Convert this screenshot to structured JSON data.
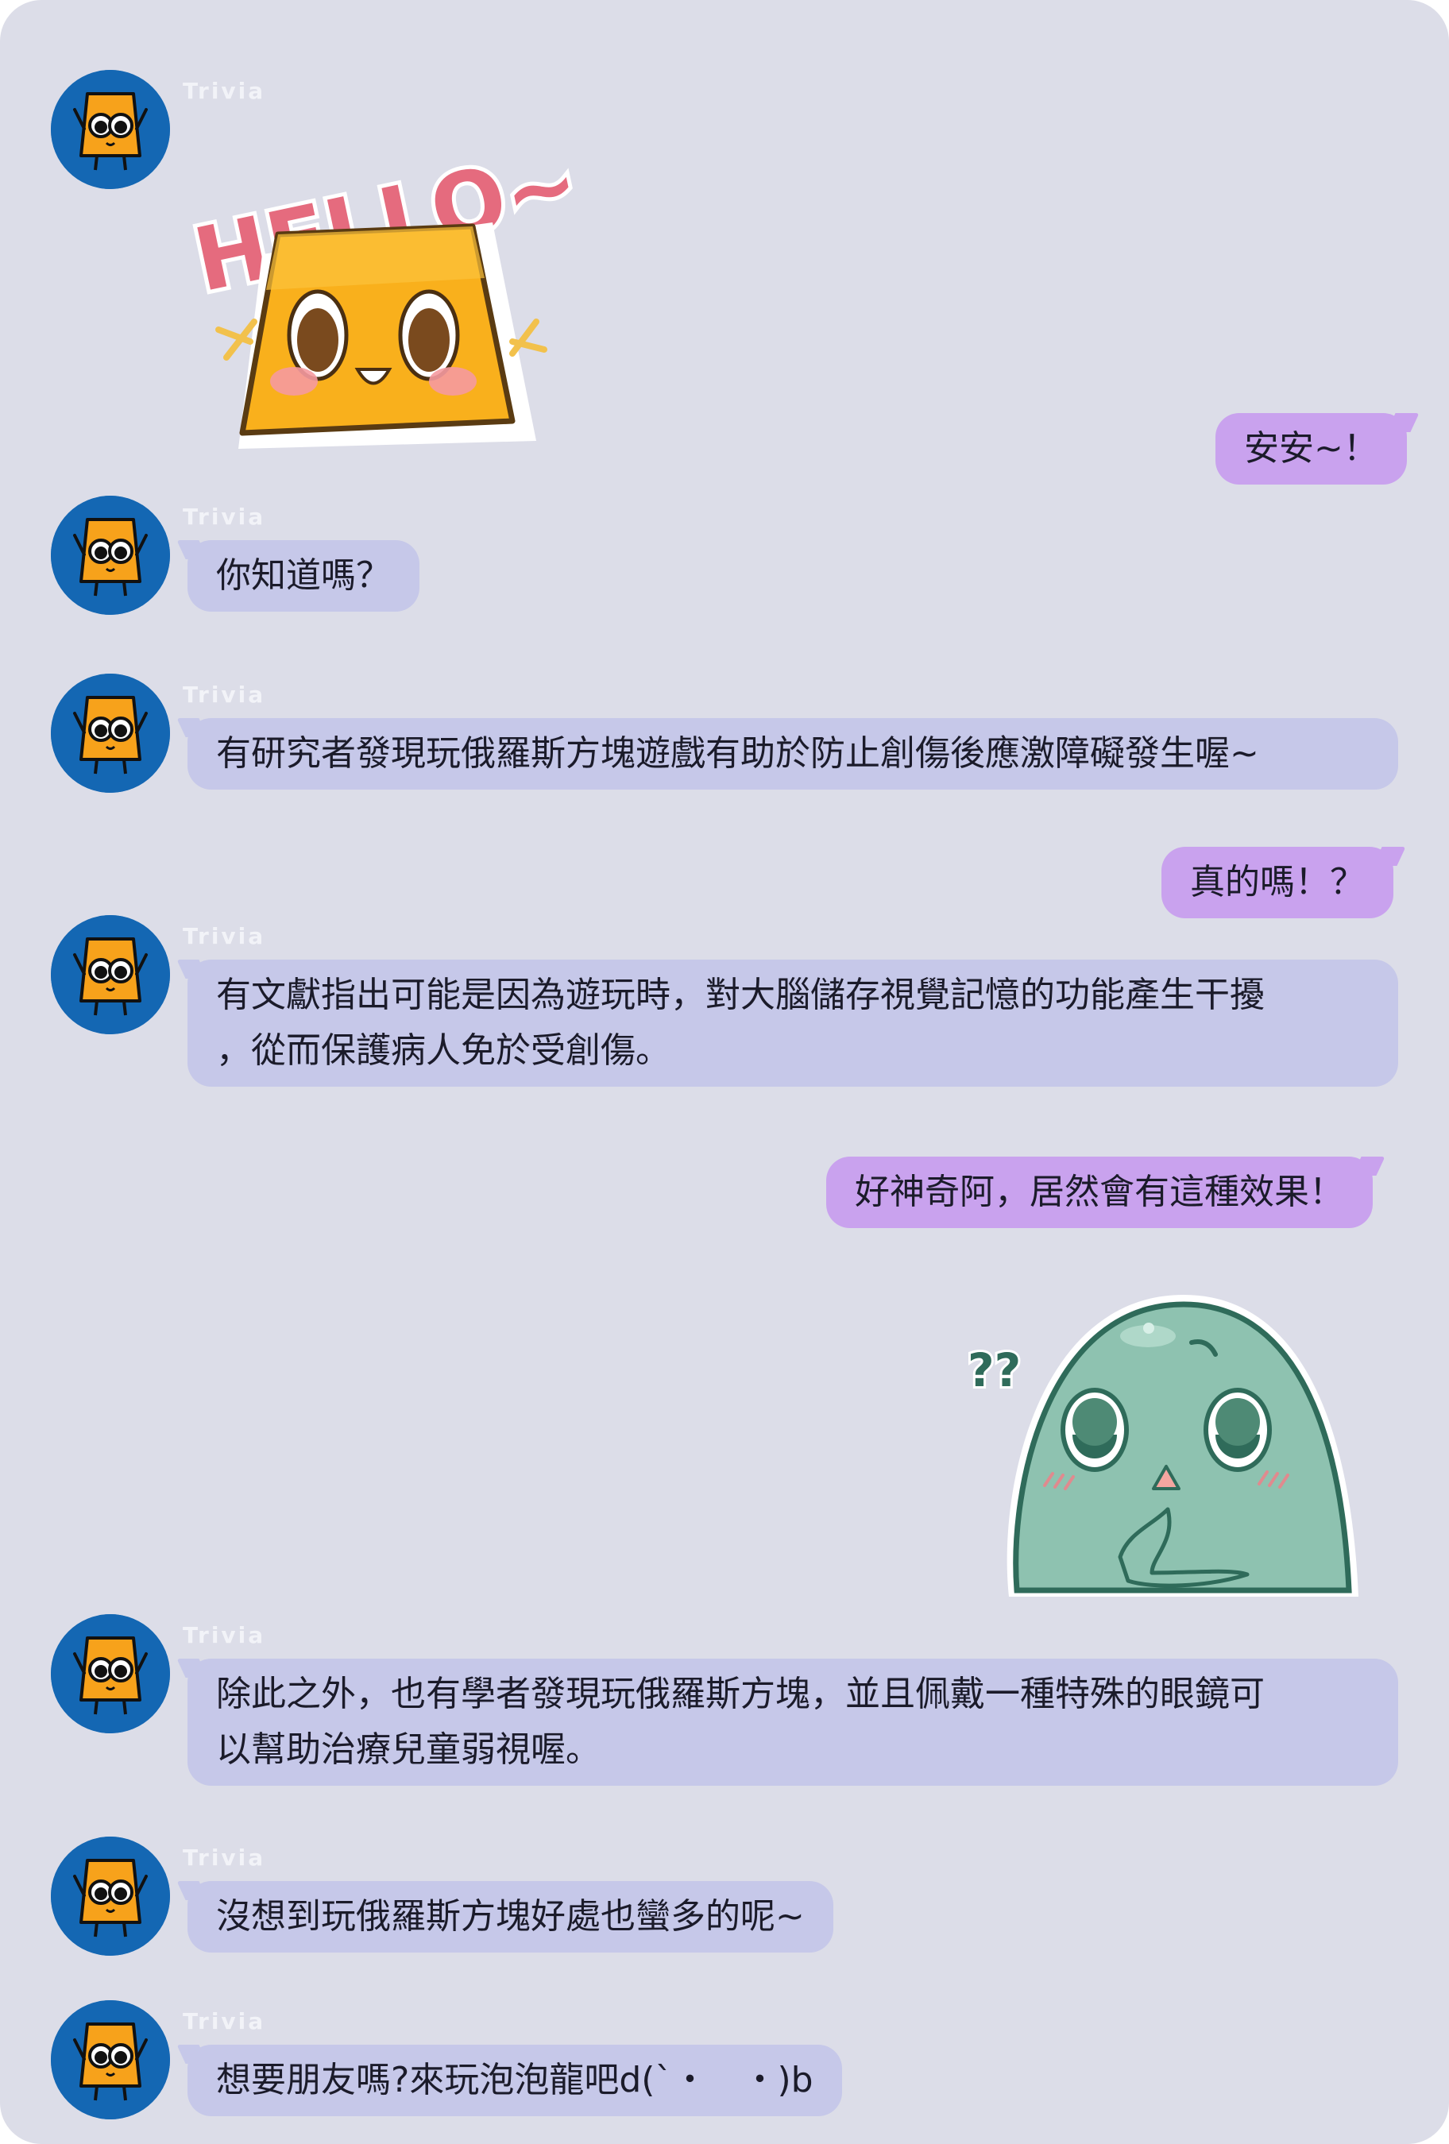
{
  "sender_name": "Trivia",
  "colors": {
    "panel_bg": "#dcdde8",
    "incoming_bubble": "#c6c8e9",
    "outgoing_bubble": "#c9a2ee",
    "avatar_bg": "#1467b3",
    "character_orange": "#f7a21b"
  },
  "messages": [
    {
      "from": "Trivia",
      "type": "sticker",
      "sticker": "hello-cheese-sticker",
      "text": "HELLO~"
    },
    {
      "from": "me",
      "type": "text",
      "text": "安安~！"
    },
    {
      "from": "Trivia",
      "type": "text",
      "text": "你知道嗎？"
    },
    {
      "from": "Trivia",
      "type": "text",
      "text": "有研究者發現玩俄羅斯方塊遊戲有助於防止創傷後應激障礙發生喔~"
    },
    {
      "from": "me",
      "type": "text",
      "text": "真的嗎！？"
    },
    {
      "from": "Trivia",
      "type": "text",
      "lines": [
        "有文獻指出可能是因為遊玩時，對大腦儲存視覺記憶的功能產生干擾",
        "，從而保護病人免於受創傷。"
      ]
    },
    {
      "from": "me",
      "type": "text",
      "text": "好神奇阿，居然會有這種效果！"
    },
    {
      "from": "me",
      "type": "sticker",
      "sticker": "confused-green-blob-sticker",
      "text": "??"
    },
    {
      "from": "Trivia",
      "type": "text",
      "lines": [
        "除此之外，也有學者發現玩俄羅斯方塊，並且佩戴一種特殊的眼鏡可",
        "以幫助治療兒童弱視喔。"
      ]
    },
    {
      "from": "Trivia",
      "type": "text",
      "text": "沒想到玩俄羅斯方塊好處也蠻多的呢~"
    },
    {
      "from": "Trivia",
      "type": "text",
      "text": "想要朋友嗎?來玩泡泡龍吧d(`・　・)b"
    }
  ]
}
